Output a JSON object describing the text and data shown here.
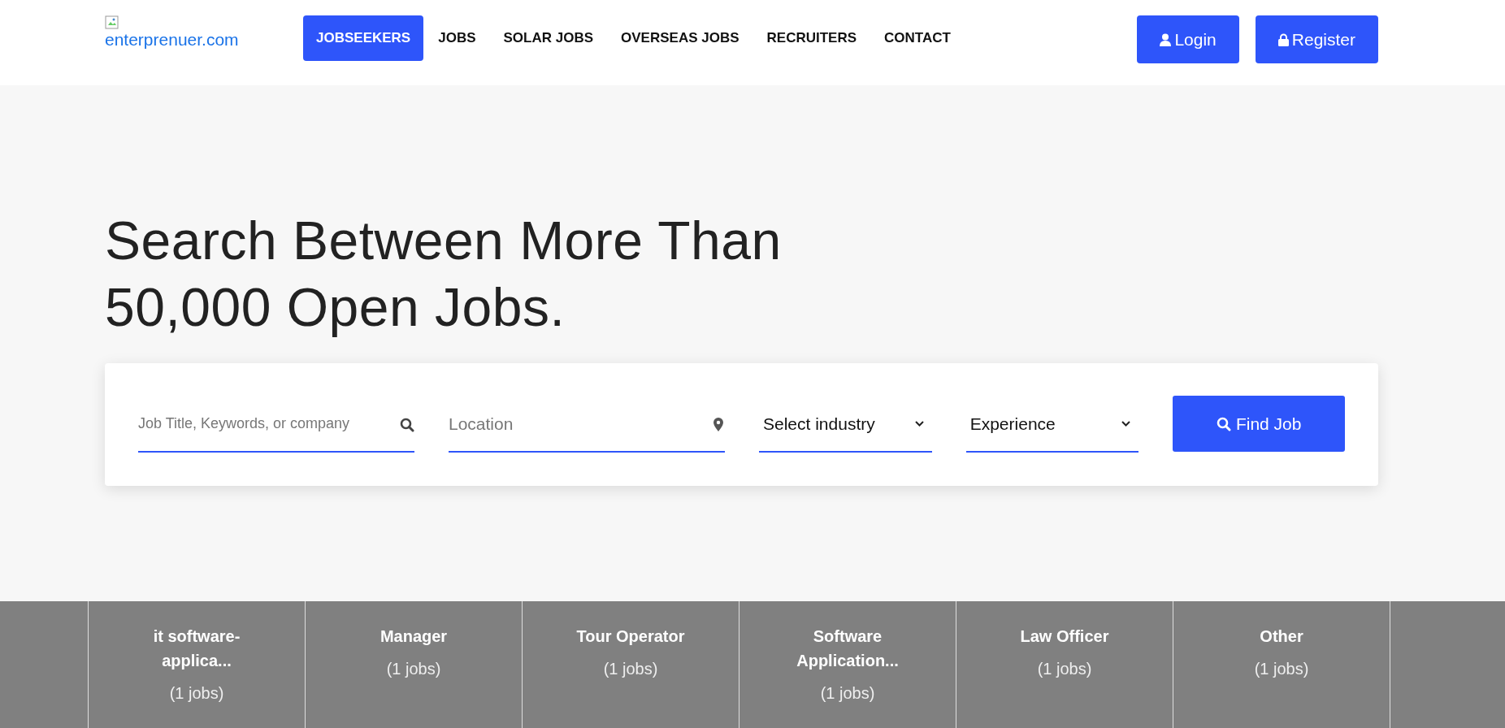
{
  "logo": {
    "alt_text": "enterprenuer.com"
  },
  "nav": [
    {
      "label": "JOBSEEKERS",
      "selected": true
    },
    {
      "label": "JOBS",
      "selected": false
    },
    {
      "label": "SOLAR JOBS",
      "selected": false
    },
    {
      "label": "OVERSEAS JOBS",
      "selected": false
    },
    {
      "label": "RECRUITERS",
      "selected": false
    },
    {
      "label": "CONTACT",
      "selected": false
    }
  ],
  "auth_buttons": [
    {
      "kind": "user",
      "label": "Login"
    },
    {
      "kind": "lock",
      "label": "Register"
    }
  ],
  "hero": {
    "heading_lines": [
      "Search Between More Than",
      "50,000 Open Jobs."
    ]
  },
  "search": {
    "fields": [
      {
        "kind": "keyword",
        "placeholder": "Job Title, Keywords, or company"
      },
      {
        "kind": "location",
        "placeholder": "Location"
      },
      {
        "kind": "select",
        "value": "Select industry"
      },
      {
        "kind": "select",
        "value": "Experience"
      }
    ],
    "button": "Find Job"
  },
  "categories": [
    {
      "name": "it software-applica...",
      "count": "(1 jobs)"
    },
    {
      "name": "Manager",
      "count": "(1 jobs)"
    },
    {
      "name": "Tour Operator",
      "count": "(1 jobs)"
    },
    {
      "name": "Software Application...",
      "count": "(1 jobs)"
    },
    {
      "name": "Law Officer",
      "count": "(1 jobs)"
    },
    {
      "name": "Other",
      "count": "(1 jobs)"
    }
  ]
}
